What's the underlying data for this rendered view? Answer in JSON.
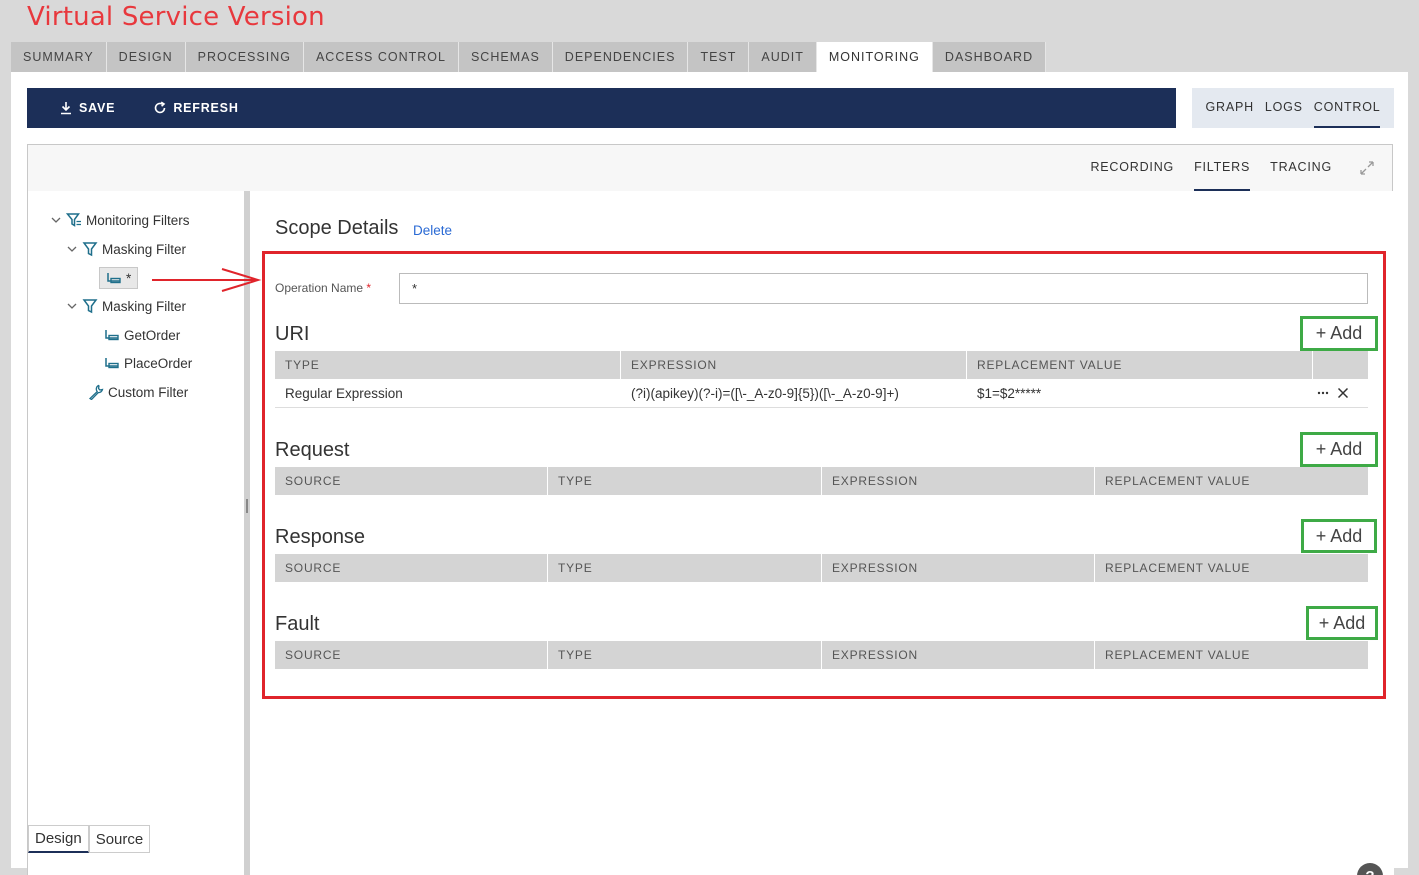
{
  "window": {
    "title": "Virtual Service Version"
  },
  "main_tabs": [
    {
      "label": "SUMMARY",
      "active": false
    },
    {
      "label": "DESIGN",
      "active": false
    },
    {
      "label": "PROCESSING",
      "active": false
    },
    {
      "label": "ACCESS CONTROL",
      "active": false
    },
    {
      "label": "SCHEMAS",
      "active": false
    },
    {
      "label": "DEPENDENCIES",
      "active": false
    },
    {
      "label": "TEST",
      "active": false
    },
    {
      "label": "AUDIT",
      "active": false
    },
    {
      "label": "MONITORING",
      "active": true
    },
    {
      "label": "DASHBOARD",
      "active": false
    }
  ],
  "toolbar": {
    "save_label": "SAVE",
    "refresh_label": "REFRESH"
  },
  "view_tabs": [
    {
      "label": "GRAPH",
      "active": false
    },
    {
      "label": "LOGS",
      "active": false
    },
    {
      "label": "CONTROL",
      "active": true
    }
  ],
  "sub_tabs": [
    {
      "label": "RECORDING",
      "active": false
    },
    {
      "label": "FILTERS",
      "active": true
    },
    {
      "label": "TRACING",
      "active": false
    }
  ],
  "tree": {
    "root": "Monitoring Filters",
    "masking_filter_1": "Masking Filter",
    "scope_star": "*",
    "masking_filter_2": "Masking Filter",
    "get_order": "GetOrder",
    "place_order": "PlaceOrder",
    "custom_filter": "Custom Filter"
  },
  "details": {
    "title": "Scope Details",
    "delete_label": "Delete",
    "operation_label": "Operation Name",
    "required_mark": "*",
    "operation_value": "*"
  },
  "sections": {
    "uri": {
      "title": "URI",
      "add_label": "+ Add",
      "columns": [
        "TYPE",
        "EXPRESSION",
        "REPLACEMENT VALUE"
      ],
      "rows": [
        {
          "type": "Regular Expression",
          "expression": "(?i)(apikey)(?-i)=([\\-_A-z0-9]{5})([\\-_A-z0-9]+)",
          "replacement": "$1=$2*****"
        }
      ]
    },
    "request": {
      "title": "Request",
      "add_label": "+ Add",
      "columns": [
        "SOURCE",
        "TYPE",
        "EXPRESSION",
        "REPLACEMENT VALUE"
      ]
    },
    "response": {
      "title": "Response",
      "add_label": "+ Add",
      "columns": [
        "SOURCE",
        "TYPE",
        "EXPRESSION",
        "REPLACEMENT VALUE"
      ]
    },
    "fault": {
      "title": "Fault",
      "add_label": "+ Add",
      "columns": [
        "SOURCE",
        "TYPE",
        "EXPRESSION",
        "REPLACEMENT VALUE"
      ]
    }
  },
  "help_label": "?",
  "bottom_tabs": [
    {
      "label": "Design",
      "active": true
    },
    {
      "label": "Source",
      "active": false
    }
  ],
  "colors": {
    "title_red": "#e8383d",
    "toolbar_navy": "#1c2f58",
    "highlight_red": "#e0242b",
    "highlight_green": "#3eaa46",
    "link_blue": "#2a6ad4"
  }
}
